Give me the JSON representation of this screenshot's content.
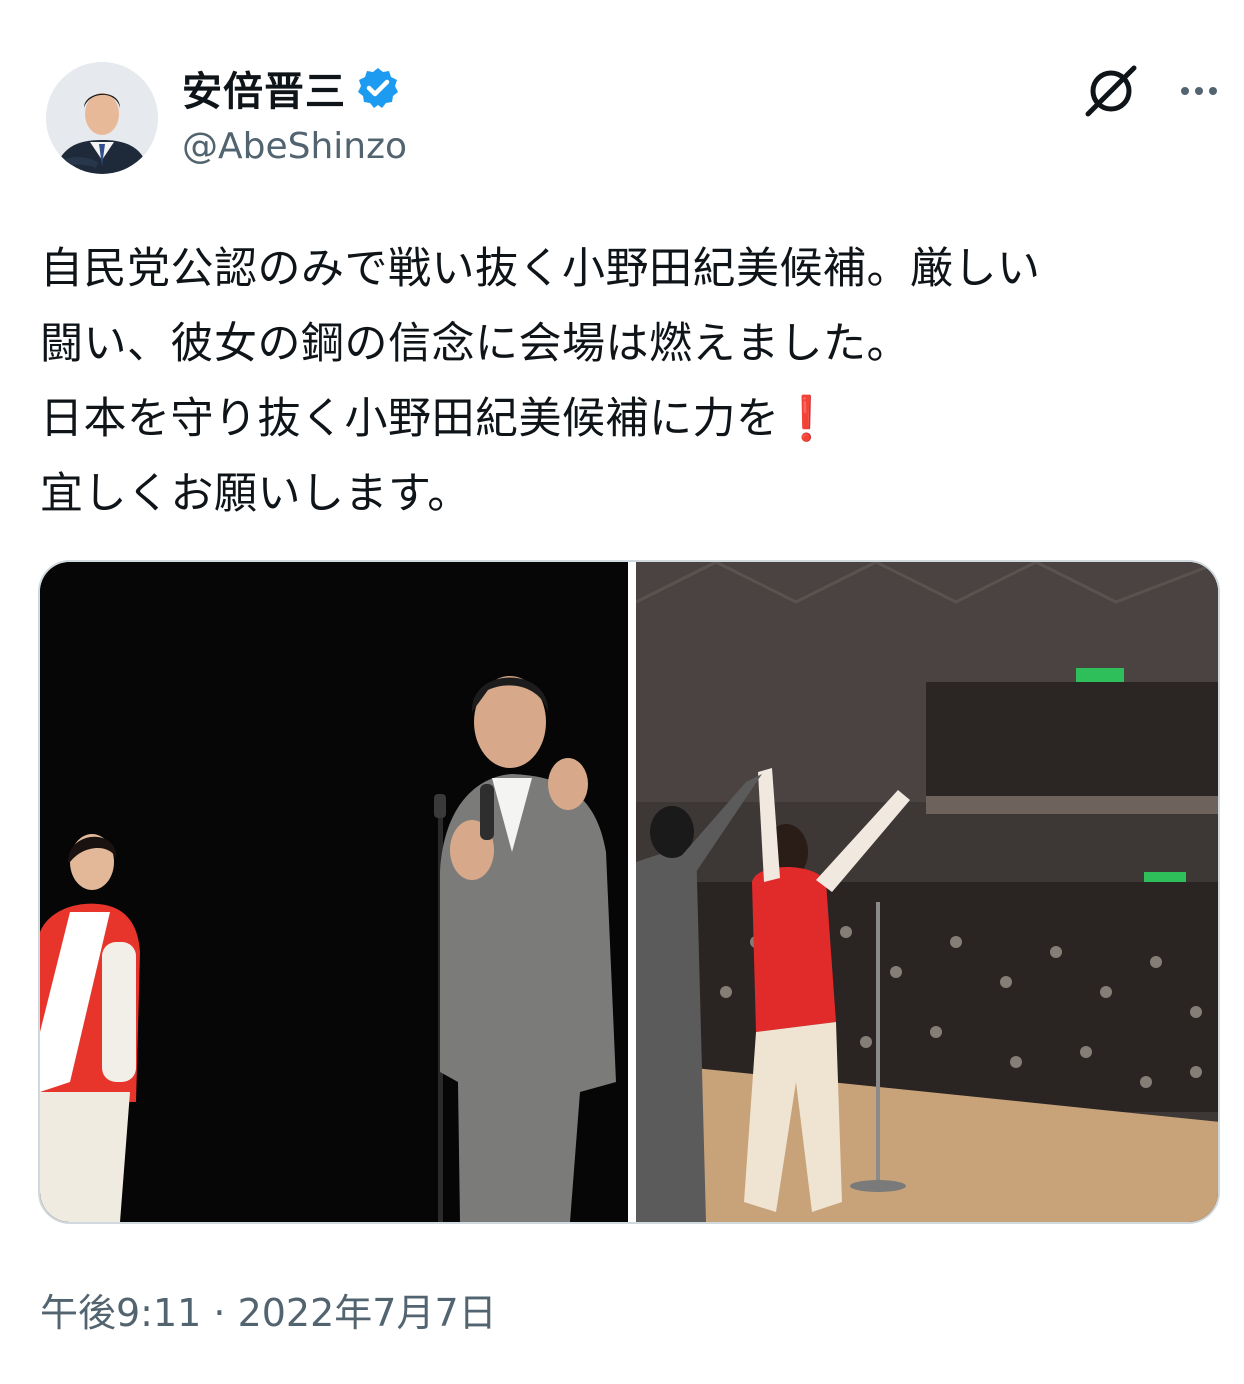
{
  "user": {
    "display_name": "安倍晋三",
    "handle": "@AbeShinzo",
    "verified": true,
    "verified_color": "#1d9bf0"
  },
  "header_icons": {
    "grok": "grok-icon",
    "more": "more-icon"
  },
  "tweet": {
    "lines": [
      "自民党公認のみで戦い抜く小野田紀美候補。厳しい",
      "闘い、彼女の鋼の信念に会場は燃えました。",
      "日本を守り抜く小野田紀美候補に力を",
      "宜しくお願いします。"
    ],
    "emoji": "❗"
  },
  "media": {
    "photos": [
      "campaign-photo-left",
      "campaign-photo-right"
    ]
  },
  "footer": {
    "timestamp": "午後9:11 · 2022年7月7日"
  },
  "colors": {
    "text": "#0f1419",
    "secondary": "#536471",
    "border": "#cfd9de",
    "accent": "#1d9bf0",
    "emoji_red": "#d0021b"
  }
}
